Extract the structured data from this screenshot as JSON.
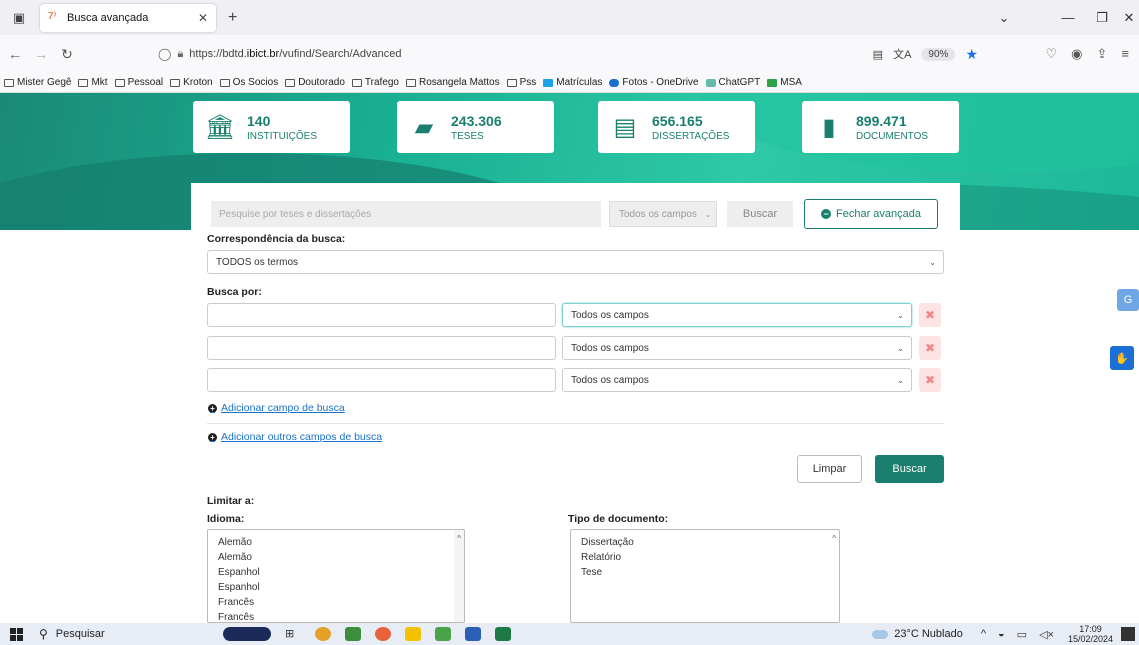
{
  "browser": {
    "tab_title": "Busca avançada",
    "new_tab": "+",
    "url_prefix": "https://bdtd.",
    "url_domain": "ibict.br",
    "url_path": "/vufind/Search/Advanced",
    "zoom": "90%"
  },
  "bookmarks": [
    {
      "label": "Mister Gegê",
      "icon": "folder-icon"
    },
    {
      "label": "Mkt",
      "icon": "folder-icon"
    },
    {
      "label": "Pessoal",
      "icon": "folder-icon"
    },
    {
      "label": "Kroton",
      "icon": "folder-icon"
    },
    {
      "label": "Os Socios",
      "icon": "folder-icon"
    },
    {
      "label": "Doutorado",
      "icon": "folder-icon"
    },
    {
      "label": "Trafego",
      "icon": "folder-icon"
    },
    {
      "label": "Rosangela Mattos",
      "icon": "folder-icon"
    },
    {
      "label": "Pss",
      "icon": "folder-icon"
    },
    {
      "label": "Matrículas",
      "icon": "app-icon"
    },
    {
      "label": "Fotos - OneDrive",
      "icon": "cloud-icon"
    },
    {
      "label": "ChatGPT",
      "icon": "chatgpt-icon"
    },
    {
      "label": "MSA",
      "icon": "msa-icon"
    }
  ],
  "stats": [
    {
      "number": "140",
      "label": "INSTITUIÇÕES",
      "icon": "institution-icon"
    },
    {
      "number": "243.306",
      "label": "TESES",
      "icon": "book-icon"
    },
    {
      "number": "656.165",
      "label": "DISSERTAÇÕES",
      "icon": "document-icon"
    },
    {
      "number": "899.471",
      "label": "DOCUMENTOS",
      "icon": "file-icon"
    }
  ],
  "search": {
    "placeholder": "Pesquise por teses e dissertações",
    "scope": "Todos os campos",
    "buscar": "Buscar",
    "fechar": "Fechar avançada"
  },
  "form": {
    "match_label": "Correspondência da busca:",
    "match_value": "TODOS os termos",
    "busca_por_label": "Busca por:",
    "rows": [
      {
        "field": "Todos os campos"
      },
      {
        "field": "Todos os campos"
      },
      {
        "field": "Todos os campos"
      }
    ],
    "add_field": "Adicionar campo de busca",
    "add_other": "Adicionar outros campos de busca",
    "limpar": "Limpar",
    "buscar": "Buscar"
  },
  "limits": {
    "title": "Limitar a:",
    "idioma_label": "Idioma:",
    "idioma_options": [
      "Alemão",
      "Alemão",
      "Espanhol",
      "Espanhol",
      "Francês",
      "Francês"
    ],
    "tipo_label": "Tipo de documento:",
    "tipo_options": [
      "Dissertação",
      "Relatório",
      "Tese"
    ]
  },
  "taskbar": {
    "search": "Pesquisar",
    "weather": "23°C  Nublado",
    "time": "17:09",
    "date": "15/02/2024"
  },
  "colors": {
    "brand": "#1a7f6e",
    "hero": "#19b094",
    "link": "#1a73c8",
    "danger_bg": "#fde3e3"
  }
}
